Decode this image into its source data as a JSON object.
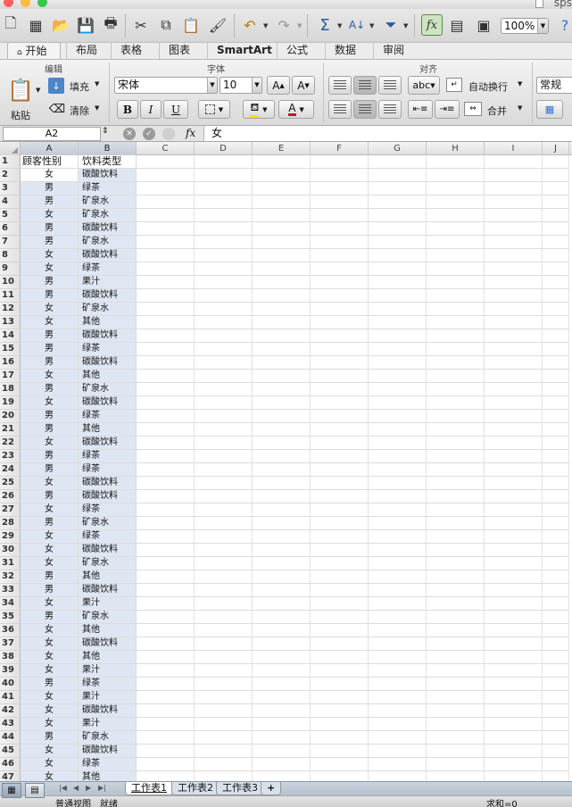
{
  "window": {
    "title_text": "sps"
  },
  "toolbar": {
    "zoom": "100%",
    "fx_label": "fx"
  },
  "ribbon_tabs": [
    "开始",
    "布局",
    "表格",
    "图表",
    "SmartArt",
    "公式",
    "数据",
    "审阅"
  ],
  "ribbon": {
    "groups": {
      "edit": "编辑",
      "font": "字体",
      "align": "对齐"
    },
    "paste": "粘贴",
    "fill": "填充",
    "clear": "清除",
    "font_name": "宋体",
    "font_size": "10",
    "bold": "B",
    "italic": "I",
    "underline": "U",
    "wrap_text": "自动换行",
    "merge": "合并",
    "number_format": "常规",
    "font_color_letter": "A",
    "abc": "abc"
  },
  "formula_bar": {
    "cell_ref": "A2",
    "fx": "fx",
    "value": "女"
  },
  "columns": [
    "A",
    "B",
    "C",
    "D",
    "E",
    "F",
    "G",
    "H",
    "I",
    "J"
  ],
  "sheet": {
    "header": [
      "顾客性别",
      "饮料类型"
    ],
    "rows": [
      [
        "女",
        "碳酸饮料"
      ],
      [
        "男",
        "绿茶"
      ],
      [
        "男",
        "矿泉水"
      ],
      [
        "女",
        "矿泉水"
      ],
      [
        "男",
        "碳酸饮料"
      ],
      [
        "男",
        "矿泉水"
      ],
      [
        "女",
        "碳酸饮料"
      ],
      [
        "女",
        "绿茶"
      ],
      [
        "男",
        "果汁"
      ],
      [
        "男",
        "碳酸饮料"
      ],
      [
        "女",
        "矿泉水"
      ],
      [
        "女",
        "其他"
      ],
      [
        "男",
        "碳酸饮料"
      ],
      [
        "男",
        "绿茶"
      ],
      [
        "男",
        "碳酸饮料"
      ],
      [
        "女",
        "其他"
      ],
      [
        "男",
        "矿泉水"
      ],
      [
        "女",
        "碳酸饮料"
      ],
      [
        "男",
        "绿茶"
      ],
      [
        "男",
        "其他"
      ],
      [
        "女",
        "碳酸饮料"
      ],
      [
        "男",
        "绿茶"
      ],
      [
        "男",
        "绿茶"
      ],
      [
        "女",
        "碳酸饮料"
      ],
      [
        "男",
        "碳酸饮料"
      ],
      [
        "女",
        "绿茶"
      ],
      [
        "男",
        "矿泉水"
      ],
      [
        "女",
        "绿茶"
      ],
      [
        "女",
        "碳酸饮料"
      ],
      [
        "女",
        "矿泉水"
      ],
      [
        "男",
        "其他"
      ],
      [
        "男",
        "碳酸饮料"
      ],
      [
        "女",
        "果汁"
      ],
      [
        "男",
        "矿泉水"
      ],
      [
        "女",
        "其他"
      ],
      [
        "女",
        "碳酸饮料"
      ],
      [
        "女",
        "其他"
      ],
      [
        "女",
        "果汁"
      ],
      [
        "男",
        "绿茶"
      ],
      [
        "女",
        "果汁"
      ],
      [
        "女",
        "碳酸饮料"
      ],
      [
        "女",
        "果汁"
      ],
      [
        "男",
        "矿泉水"
      ],
      [
        "女",
        "碳酸饮料"
      ],
      [
        "女",
        "绿茶"
      ],
      [
        "女",
        "其他"
      ]
    ]
  },
  "sheet_tabs": [
    "工作表1",
    "工作表2",
    "工作表3",
    "+"
  ],
  "status": {
    "view_mode": "普通视图",
    "state": "就绪",
    "sum": "求和=0"
  },
  "colors": {
    "selection_border": "#1a3f7a",
    "selection_fill": "#dfe6f3",
    "accent_green": "#cde3c1"
  }
}
